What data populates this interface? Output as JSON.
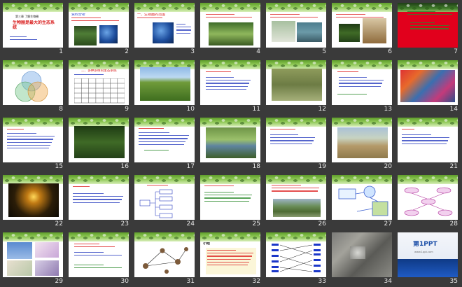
{
  "app": {
    "view": "slide-sorter"
  },
  "accent": "#f6a623",
  "slides": [
    {
      "n": "1",
      "title": "生物圈是最大的生态系统",
      "sub": "第三章 了解生物圈"
    },
    {
      "n": "2",
      "title": "资料分析",
      "sub": ""
    },
    {
      "n": "3",
      "title": "一、生物圈的范围",
      "sub": ""
    },
    {
      "n": "4",
      "title": "",
      "sub": ""
    },
    {
      "n": "5",
      "title": "",
      "sub": ""
    },
    {
      "n": "6",
      "title": "",
      "sub": ""
    },
    {
      "n": "7",
      "title": "",
      "sub": ""
    },
    {
      "n": "8",
      "title": "",
      "sub": ""
    },
    {
      "n": "9",
      "title": "二、多种多样的生态系统",
      "sub": ""
    },
    {
      "n": "10",
      "title": "",
      "sub": ""
    },
    {
      "n": "11",
      "title": "",
      "sub": ""
    },
    {
      "n": "12",
      "title": "",
      "sub": ""
    },
    {
      "n": "13",
      "title": "",
      "sub": ""
    },
    {
      "n": "14",
      "title": "",
      "sub": ""
    },
    {
      "n": "15",
      "title": "",
      "sub": ""
    },
    {
      "n": "16",
      "title": "",
      "sub": ""
    },
    {
      "n": "17",
      "title": "",
      "sub": ""
    },
    {
      "n": "18",
      "title": "",
      "sub": ""
    },
    {
      "n": "19",
      "title": "",
      "sub": ""
    },
    {
      "n": "20",
      "title": "",
      "sub": ""
    },
    {
      "n": "21",
      "title": "",
      "sub": ""
    },
    {
      "n": "22",
      "title": "",
      "sub": ""
    },
    {
      "n": "23",
      "title": "",
      "sub": ""
    },
    {
      "n": "24",
      "title": "",
      "sub": ""
    },
    {
      "n": "25",
      "title": "",
      "sub": ""
    },
    {
      "n": "26",
      "title": "",
      "sub": ""
    },
    {
      "n": "27",
      "title": "",
      "sub": ""
    },
    {
      "n": "28",
      "title": "",
      "sub": ""
    },
    {
      "n": "29",
      "title": "",
      "sub": ""
    },
    {
      "n": "30",
      "title": "",
      "sub": ""
    },
    {
      "n": "31",
      "title": "",
      "sub": ""
    },
    {
      "n": "32",
      "title": "小结",
      "sub": ""
    },
    {
      "n": "33",
      "title": "",
      "sub": ""
    },
    {
      "n": "34",
      "title": "",
      "sub": ""
    },
    {
      "n": "35",
      "title": "第1PPT",
      "sub": "www.1ppt.com"
    }
  ]
}
